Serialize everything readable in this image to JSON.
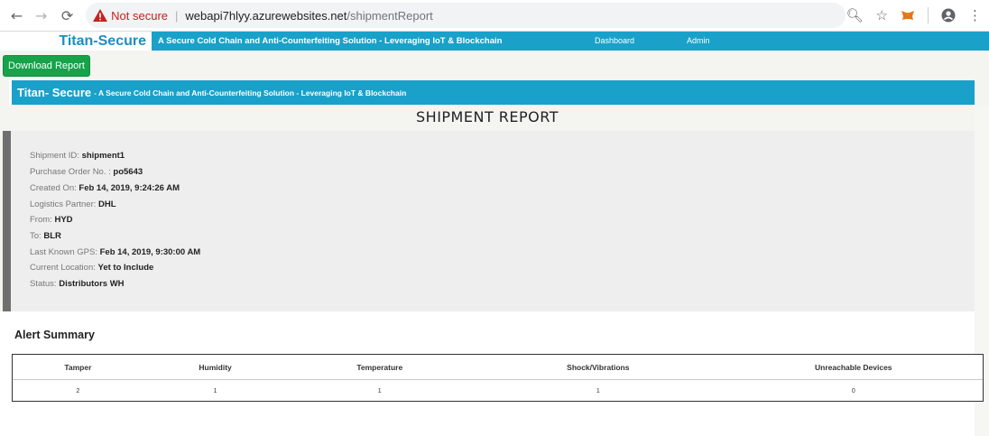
{
  "browser": {
    "not_secure": "Not secure",
    "url_host": "webapi7hlyy.azurewebsites.net",
    "url_path": "/shipmentReport"
  },
  "navbar": {
    "brand": "Titan-Secure",
    "tagline": "A Secure Cold Chain and Anti-Counterfeiting Solution - Leveraging IoT & Blockchain",
    "links": [
      "Dashboard",
      "Admin"
    ]
  },
  "download_button": "Download Report",
  "report_header": {
    "brand": "Titan- Secure",
    "tagline": "- A Secure Cold Chain and Anti-Counterfeiting Solution - Leveraging IoT & Blockchain"
  },
  "report_title": "SHIPMENT REPORT",
  "details": [
    {
      "label": "Shipment ID:",
      "value": "shipment1"
    },
    {
      "label": "Purchase Order No. :",
      "value": "po5643"
    },
    {
      "label": "Created On:",
      "value": "Feb 14, 2019, 9:24:26 AM"
    },
    {
      "label": "Logistics Partner:",
      "value": "DHL"
    },
    {
      "label": "From:",
      "value": "HYD"
    },
    {
      "label": "To:",
      "value": "BLR"
    },
    {
      "label": "Last Known GPS:",
      "value": "Feb 14, 2019, 9:30:00 AM"
    },
    {
      "label": "Current Location:",
      "value": "Yet to Include"
    },
    {
      "label": "Status:",
      "value": "Distributors WH"
    }
  ],
  "alert_summary": {
    "title": "Alert Summary",
    "columns": [
      "Tamper",
      "Humidity",
      "Temperature",
      "Shock/Vibrations",
      "Unreachable Devices"
    ],
    "values": [
      "2",
      "1",
      "1",
      "1",
      "0"
    ]
  },
  "colors": {
    "accent": "#19a1c9",
    "download": "#16a34a",
    "not_secure": "#c5221f"
  }
}
